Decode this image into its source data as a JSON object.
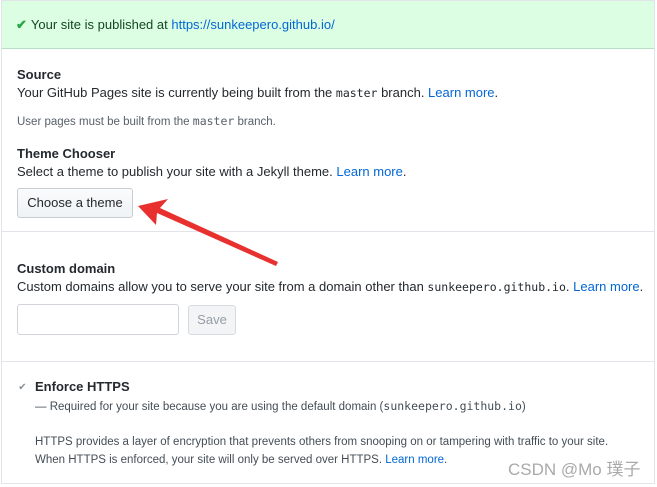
{
  "flash": {
    "text": "Your site is published at ",
    "url": "https://sunkeepero.github.io/"
  },
  "source": {
    "heading": "Source",
    "desc_before": "Your GitHub Pages site is currently being built from the ",
    "branch": "master",
    "desc_after": " branch. ",
    "learn_more": "Learn more",
    "note_before": "User pages must be built from the ",
    "note_branch": "master",
    "note_after": " branch."
  },
  "theme": {
    "heading": "Theme Chooser",
    "desc": "Select a theme to publish your site with a Jekyll theme. ",
    "learn_more": "Learn more",
    "button": "Choose a theme"
  },
  "domain": {
    "heading": "Custom domain",
    "desc_before": "Custom domains allow you to serve your site from a domain other than ",
    "domain_code": "sunkeepero.github.io",
    "desc_after": ". ",
    "learn_more": "Learn more",
    "input_value": "",
    "save": "Save"
  },
  "https": {
    "label": "Enforce HTTPS",
    "required_before": "— Required for your site because you are using the default domain (",
    "required_domain": "sunkeepero.github.io",
    "required_after": ")",
    "info_line1": "HTTPS provides a layer of encryption that prevents others from snooping on or tampering with traffic to your site.",
    "info_line2": "When HTTPS is enforced, your site will only be served over HTTPS. ",
    "learn_more": "Learn more"
  },
  "watermark": "CSDN @Mo 璞子",
  "colors": {
    "flash_bg": "#dcffe4",
    "link": "#0366d6",
    "arrow": "#e8312f"
  },
  "icons": {
    "flash": "check-icon",
    "https_checkbox": "checkbox-checked-icon"
  }
}
